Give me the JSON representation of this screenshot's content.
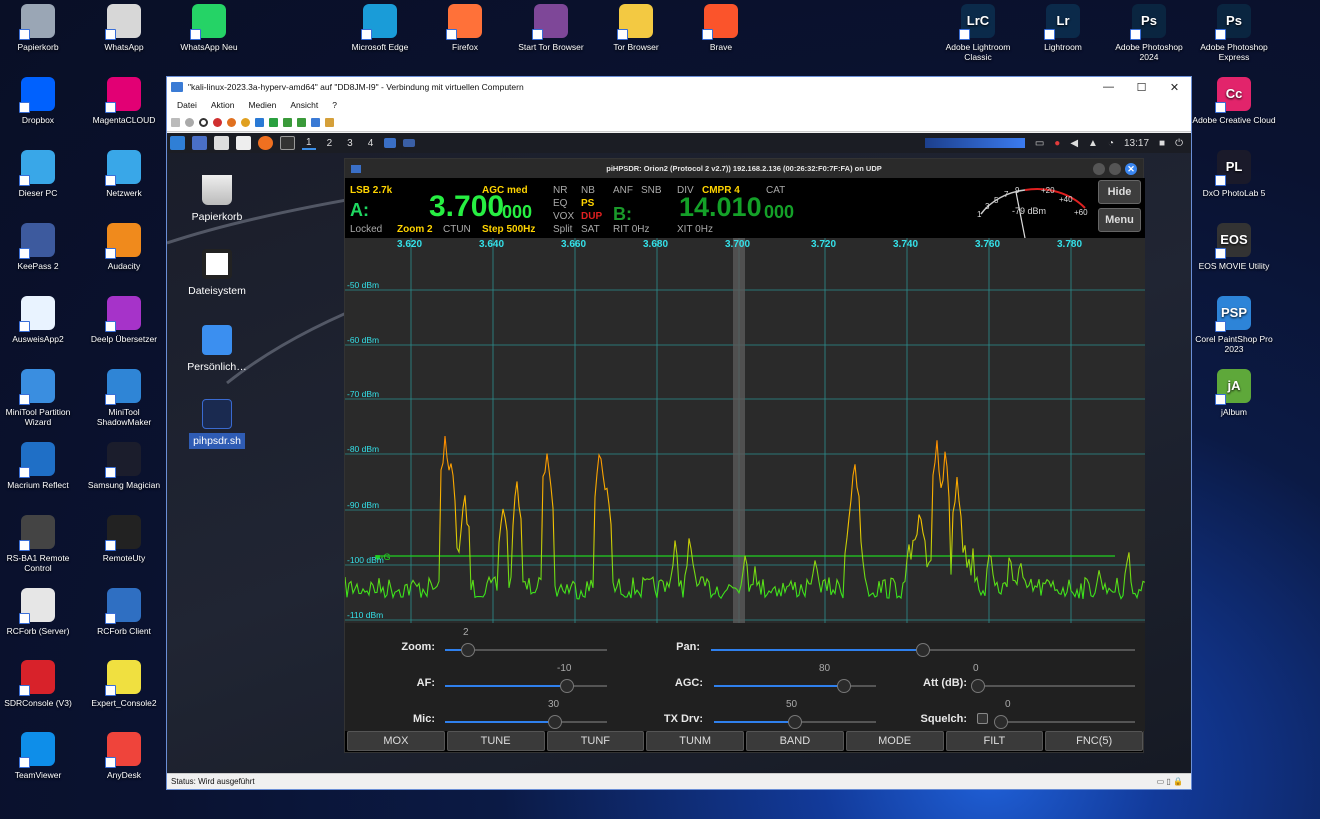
{
  "desktop": {
    "icons_left": [
      {
        "label": "Papierkorb",
        "color": "#9aa6b5",
        "icon": "recycle-bin-icon"
      },
      {
        "label": "WhatsApp",
        "color": "#d7d7d7",
        "icon": "whatsapp-icon"
      },
      {
        "label": "WhatsApp Neu",
        "color": "#25d366",
        "icon": "whatsapp-icon"
      },
      {
        "label": "Dropbox",
        "color": "#0061fe",
        "icon": "dropbox-icon"
      },
      {
        "label": "MagentaCLOUD",
        "color": "#e20074",
        "icon": "cloud-icon"
      },
      {
        "label": "Dieser PC",
        "color": "#39a7e8",
        "icon": "computer-icon"
      },
      {
        "label": "Netzwerk",
        "color": "#39a7e8",
        "icon": "network-icon"
      },
      {
        "label": "KeePass 2",
        "color": "#3d5a9e",
        "icon": "keepass-icon"
      },
      {
        "label": "Audacity",
        "color": "#f08a1c",
        "icon": "audacity-icon"
      },
      {
        "label": "AusweisApp2",
        "color": "#e9f3ff",
        "icon": "ausweis-icon"
      },
      {
        "label": "Deelp Übersetzer",
        "color": "#a633c9",
        "icon": "deepl-icon"
      },
      {
        "label": "MiniTool Partition Wizard",
        "color": "#3a8ee0",
        "icon": "partition-icon"
      },
      {
        "label": "MiniTool ShadowMaker",
        "color": "#2f85d6",
        "icon": "shadowmaker-icon"
      },
      {
        "label": "Macrium Reflect",
        "color": "#1f6fc6",
        "icon": "macrium-icon"
      },
      {
        "label": "Samsung Magician",
        "color": "#1b1d2c",
        "icon": "samsung-icon"
      },
      {
        "label": "RS-BA1 Remote Control",
        "color": "#444",
        "icon": "rsba1-icon"
      },
      {
        "label": "RemoteUty",
        "color": "#222",
        "icon": "icom-icon"
      },
      {
        "label": "RCForb (Server)",
        "color": "#e6e6e6",
        "icon": "rcforb-icon"
      },
      {
        "label": "RCForb Client",
        "color": "#2f6fc2",
        "icon": "rcforb-icon"
      },
      {
        "label": "SDRConsole (V3)",
        "color": "#d8222a",
        "icon": "sdrconsole-icon"
      },
      {
        "label": "Expert_Console2",
        "color": "#f0e040",
        "icon": "expert-icon"
      },
      {
        "label": "TeamViewer",
        "color": "#0e8ee9",
        "icon": "teamviewer-icon"
      },
      {
        "label": "AnyDesk",
        "color": "#ef443b",
        "icon": "anydesk-icon"
      }
    ],
    "icons_top": [
      {
        "label": "Microsoft Edge",
        "color": "#1a9cd8"
      },
      {
        "label": "Firefox",
        "color": "#ff7139"
      },
      {
        "label": "Start Tor Browser",
        "color": "#7e4798"
      },
      {
        "label": "Tor Browser",
        "color": "#f3c942"
      },
      {
        "label": "Brave",
        "color": "#fb542b"
      }
    ],
    "icons_right": [
      {
        "label": "Adobe Lightroom Classic",
        "abbr": "LrC",
        "color": "#0b2a4a"
      },
      {
        "label": "Lightroom",
        "abbr": "Lr",
        "color": "#0b2a4a"
      },
      {
        "label": "Adobe Photoshop 2024",
        "abbr": "Ps",
        "color": "#0a2540"
      },
      {
        "label": "Adobe Photoshop Express",
        "abbr": "Ps",
        "color": "#0a2540"
      },
      {
        "label": "Adobe Creative Cloud",
        "abbr": "Cc",
        "color": "#e2246b"
      },
      {
        "label": "DxO PhotoLab 5",
        "abbr": "PL",
        "color": "#1a1a2a"
      },
      {
        "label": "EOS MOVIE Utility",
        "abbr": "EOS",
        "color": "#333"
      },
      {
        "label": "Corel PaintShop Pro 2023",
        "abbr": "PSP",
        "color": "#2d84d8"
      },
      {
        "label": "jAlbum",
        "abbr": "jA",
        "color": "#5ea83a"
      }
    ]
  },
  "vm": {
    "title": "\"kali-linux-2023.3a-hyperv-amd64\" auf \"DD8JM-I9\" - Verbindung mit virtuellen Computern",
    "menu": [
      "Datei",
      "Aktion",
      "Medien",
      "Ansicht",
      "?"
    ],
    "status": "Status: Wird ausgeführt",
    "min": "—",
    "max": "☐",
    "close": "✕"
  },
  "kali": {
    "workspaces": [
      "1",
      "2",
      "3",
      "4"
    ],
    "time": "13:17",
    "desktop_icons": [
      "Papierkorb",
      "Dateisystem",
      "Persönlich…",
      "pihpsdr.sh"
    ]
  },
  "sdr": {
    "title": "piHPSDR: Orion2 (Protocol 2 v2.7)) 192.168.2.136 (00:26:32:F0:7F:FA) on UDP",
    "mode": "LSB 2.7k",
    "agc": "AGC med",
    "vfo_a_label": "A:",
    "vfo_a_main": "3.700",
    "vfo_a_sub": "000",
    "vfo_b_label": "B:",
    "vfo_b_main": "14.010",
    "vfo_b_sub": "000",
    "locked": "Locked",
    "zoom": "Zoom 2",
    "ctun": "CTUN",
    "step": "Step 500Hz",
    "flags": {
      "nr": "NR",
      "nb": "NB",
      "anf": "ANF",
      "snb": "SNB",
      "eq": "EQ",
      "ps": "PS",
      "vox": "VOX",
      "dup": "DUP",
      "split": "Split",
      "sat": "SAT",
      "div": "DIV",
      "cmpr": "CMPR 4",
      "cat": "CAT"
    },
    "rit": "RIT 0Hz",
    "xit": "XIT 0Hz",
    "hide": "Hide",
    "menu": "Menu",
    "meter": {
      "reading": "-79 dBm",
      "scale": [
        "1",
        "3",
        "5",
        "7",
        "9",
        "+20",
        "+40",
        "+60"
      ]
    },
    "freq_labels": [
      "3.620",
      "3.640",
      "3.660",
      "3.680",
      "3.700",
      "3.720",
      "3.740",
      "3.760",
      "3.780"
    ],
    "dbm_labels": [
      "-50 dBm",
      "-60 dBm",
      "-70 dBm",
      "-80 dBm",
      "-90 dBm",
      "-100 dBm",
      "-110 dBm"
    ],
    "g_label": "G",
    "controls": {
      "zoom": {
        "label": "Zoom:",
        "value": "2",
        "level": 0.14
      },
      "pan": {
        "label": "Pan:",
        "value": "",
        "level": 0.5
      },
      "af": {
        "label": "AF:",
        "value": "-10",
        "level": 0.75
      },
      "agc": {
        "label": "AGC:",
        "value": "80",
        "level": 0.8
      },
      "att": {
        "label": "Att (dB):",
        "value": "0",
        "level": 0.0
      },
      "mic": {
        "label": "Mic:",
        "value": "30",
        "level": 0.68
      },
      "txdrv": {
        "label": "TX Drv:",
        "value": "50",
        "level": 0.5
      },
      "squelch": {
        "label": "Squelch:",
        "value": "0",
        "level": 0.0
      }
    },
    "buttons": [
      "MOX",
      "TUNE",
      "TUNF",
      "TUNM",
      "BAND",
      "MODE",
      "FILT",
      "FNC(5)"
    ]
  }
}
